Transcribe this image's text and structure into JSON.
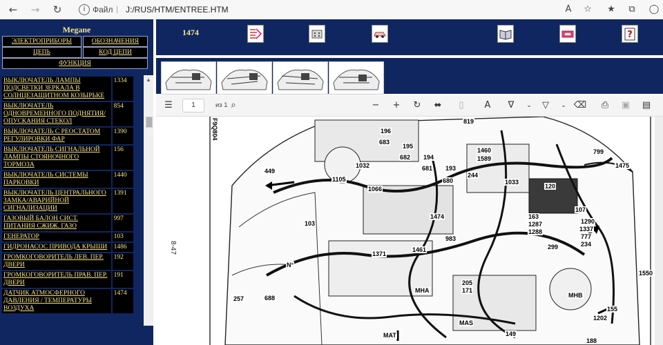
{
  "browser": {
    "scheme": "Файл",
    "url": "J:/RUS/HTM/ENTREE.HTM"
  },
  "left": {
    "title": "Megane",
    "buttons": [
      "ЭЛЕКТРОПРИБОРЫ",
      "ОБОЗНАЧЕНИЯ",
      "ЦЕПЬ",
      "КОД ЦЕПИ",
      "ФУНКЦИЯ"
    ],
    "items": [
      {
        "name": "ВЫКЛЮЧАТЕЛЬ ЛАМПЫ ПОДСВЕТКИ ЗЕРКАЛА В СОЛНЦЕЗАЩИТНОМ КОЗЫРЬКЕ",
        "code": "1334"
      },
      {
        "name": "ВЫКЛЮЧАТЕЛЬ ОДНОВРЕМЕННОГО ПОДНЯТИЯ/ ОПУСКАНИЯ СТЕКОЛ",
        "code": "854"
      },
      {
        "name": "ВЫКЛЮЧАТЕЛЬ С РЕОСТАТОМ РЕГУЛИРОВКИ ФАР",
        "code": "1390"
      },
      {
        "name": "ВЫКЛЮЧАТЕЛЬ СИГНАЛЬНОЙ ЛАМПЫ СТОЯНОЧНОГО ТОРМОЗА",
        "code": "156"
      },
      {
        "name": "ВЫКЛЮЧАТЕЛЬ СИСТЕМЫ ПАРКОВКИ",
        "code": "1440"
      },
      {
        "name": "ВЫКЛЮЧАТЕЛЬ ЦЕНТРАЛЬНОГО ЗАМКА/АВАРИЙНОЙ СИГНАЛИЗАЦИИ",
        "code": "1391"
      },
      {
        "name": "ГАЗОВЫЙ БАЛОН СИСТ. ПИТАНИЯ СЖИЖ. ГАЗО",
        "code": "997"
      },
      {
        "name": "ГЕНЕРАТОР",
        "code": "103"
      },
      {
        "name": "ГИДРОНАСОС ПРИВОДА КРЫШИ",
        "code": "1486"
      },
      {
        "name": "ГРОМКОГОВОРИТЕЛЬ ЛЕВ. ПЕР. ДВЕРИ",
        "code": "192"
      },
      {
        "name": "ГРОМКОГОВОРИТЕЛЬ ПРАВ. ПЕР. ДВЕРИ",
        "code": "191"
      },
      {
        "name": "ДАТЧИК АТМОСФЕРНОГО ДАВЛЕНИЯ / ТЕМПЕРАТУРЫ ВОЗДУХА",
        "code": "1474"
      }
    ]
  },
  "top": {
    "code": "1474",
    "icons": [
      "wiring-icon",
      "connector-icon",
      "car-icon",
      "book-icon",
      "fuse-icon",
      "help-icon"
    ]
  },
  "pdf": {
    "page": "1",
    "total": "из 1",
    "vertical_label": "8-47",
    "diagram_code": "F9Q804",
    "callouts": [
      {
        "t": "819"
      },
      {
        "t": "196"
      },
      {
        "t": "683"
      },
      {
        "t": "195"
      },
      {
        "t": "1032"
      },
      {
        "t": "682"
      },
      {
        "t": "194"
      },
      {
        "t": "681"
      },
      {
        "t": "193"
      },
      {
        "t": "1460"
      },
      {
        "t": "1589"
      },
      {
        "t": "799"
      },
      {
        "t": "1475"
      },
      {
        "t": "449"
      },
      {
        "t": "1105"
      },
      {
        "t": "1066"
      },
      {
        "t": "680"
      },
      {
        "t": "244"
      },
      {
        "t": "1033"
      },
      {
        "t": "120"
      },
      {
        "t": "107"
      },
      {
        "t": "103"
      },
      {
        "t": "1474"
      },
      {
        "t": "163"
      },
      {
        "t": "1287"
      },
      {
        "t": "1288"
      },
      {
        "t": "1290"
      },
      {
        "t": "1337"
      },
      {
        "t": "777"
      },
      {
        "t": "234"
      },
      {
        "t": "983"
      },
      {
        "t": "299"
      },
      {
        "t": "1461"
      },
      {
        "t": "1371"
      },
      {
        "t": "N°"
      },
      {
        "t": "205"
      },
      {
        "t": "171"
      },
      {
        "t": "MHA"
      },
      {
        "t": "MHB"
      },
      {
        "t": "688"
      },
      {
        "t": "155"
      },
      {
        "t": "1202"
      },
      {
        "t": "MAS"
      },
      {
        "t": "MAT"
      },
      {
        "t": "149"
      },
      {
        "t": "188"
      },
      {
        "t": "1550"
      },
      {
        "t": "257"
      }
    ]
  }
}
